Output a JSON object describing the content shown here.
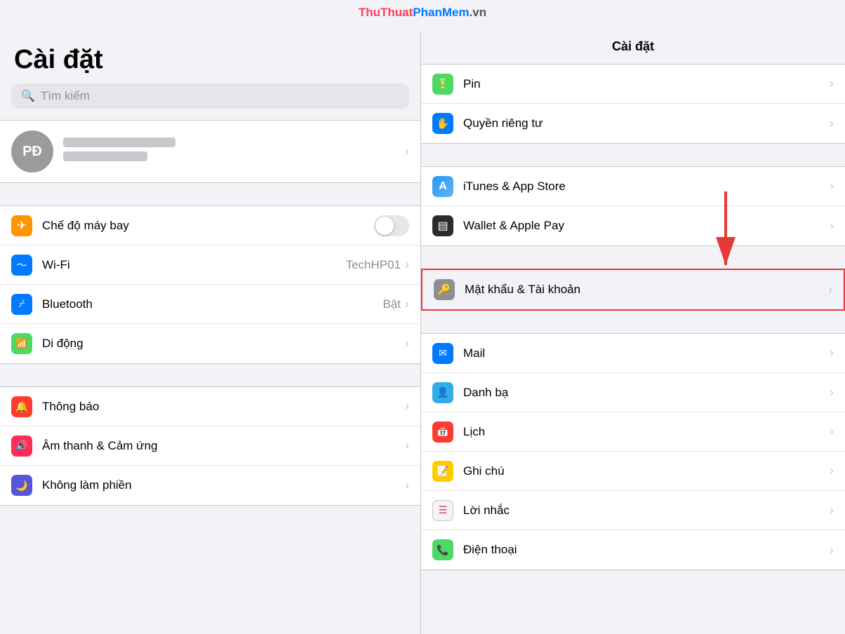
{
  "watermark": {
    "part1": "ThuThuat",
    "part2": "PhanMem",
    "part3": ".vn"
  },
  "left": {
    "title": "Cài đặt",
    "search_placeholder": "Tìm kiếm",
    "profile": {
      "initials": "PĐ"
    },
    "groups": [
      {
        "items": [
          {
            "label": "Chế độ máy bay",
            "icon_bg": "bg-orange",
            "icon": "✈",
            "has_toggle": true,
            "toggle_on": false
          },
          {
            "label": "Wi-Fi",
            "icon_bg": "bg-blue",
            "icon": "📶",
            "value": "TechHP01",
            "has_toggle": false
          },
          {
            "label": "Bluetooth",
            "icon_bg": "bg-blue",
            "icon": "✦",
            "value": "Bật",
            "has_toggle": false
          },
          {
            "label": "Di động",
            "icon_bg": "bg-green",
            "icon": "((•))",
            "value": "",
            "has_toggle": false
          }
        ]
      },
      {
        "items": [
          {
            "label": "Thông báo",
            "icon_bg": "bg-red",
            "icon": "🔔",
            "value": "",
            "has_toggle": false
          },
          {
            "label": "Âm thanh & Cảm ứng",
            "icon_bg": "bg-pink",
            "icon": "🔊",
            "value": "",
            "has_toggle": false
          },
          {
            "label": "Không làm phiền",
            "icon_bg": "bg-purple",
            "icon": "🌙",
            "value": "",
            "has_toggle": false
          }
        ]
      }
    ]
  },
  "right": {
    "title": "Cài đặt",
    "groups": [
      {
        "items": [
          {
            "label": "Pin",
            "icon_bg": "bg-green",
            "icon": "🔋"
          },
          {
            "label": "Quyền riêng tư",
            "icon_bg": "bg-blue",
            "icon": "✋"
          }
        ]
      },
      {
        "items": [
          {
            "label": "iTunes & App Store",
            "icon_bg": "bg-blue",
            "icon": "A"
          },
          {
            "label": "Wallet & Apple Pay",
            "icon_bg": "bg-dark",
            "icon": "▤"
          }
        ]
      },
      {
        "items": [
          {
            "label": "Mật khẩu & Tài khoản",
            "icon_bg": "bg-gray",
            "icon": "🔑",
            "highlighted": true
          }
        ]
      },
      {
        "items": [
          {
            "label": "Mail",
            "icon_bg": "bg-blue",
            "icon": "✉"
          },
          {
            "label": "Danh bạ",
            "icon_bg": "bg-teal",
            "icon": "👤"
          },
          {
            "label": "Lịch",
            "icon_bg": "bg-red",
            "icon": "📅"
          },
          {
            "label": "Ghi chú",
            "icon_bg": "bg-yellow",
            "icon": "📝"
          },
          {
            "label": "Lời nhắc",
            "icon_bg": "bg-gray",
            "icon": "☰"
          },
          {
            "label": "Điện thoại",
            "icon_bg": "bg-green",
            "icon": "📞"
          }
        ]
      }
    ]
  }
}
